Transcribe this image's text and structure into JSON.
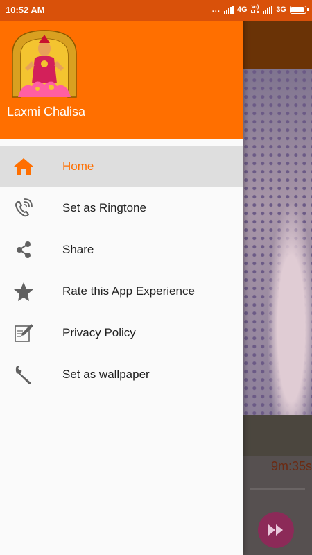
{
  "status_bar": {
    "time": "10:52 AM",
    "dots": "...",
    "network_1": "4G",
    "volte_top": "Vo)",
    "volte_bottom": "LTE",
    "network_2": "3G",
    "battery_level": 0.9
  },
  "drawer": {
    "app_name": "Laxmi Chalisa",
    "menu": [
      {
        "label": "Home",
        "icon": "home-icon",
        "active": true
      },
      {
        "label": "Set as Ringtone",
        "icon": "phone-icon",
        "active": false
      },
      {
        "label": "Share",
        "icon": "share-icon",
        "active": false
      },
      {
        "label": "Rate this App Experience",
        "icon": "star-icon",
        "active": false
      },
      {
        "label": "Privacy Policy",
        "icon": "edit-document-icon",
        "active": false
      },
      {
        "label": "Set as wallpaper",
        "icon": "wrench-icon",
        "active": false
      }
    ]
  },
  "background_app": {
    "timer": "9m:35s"
  },
  "colors": {
    "accent": "#ff6f00",
    "status_bar": "#d9510a",
    "icon_gray": "#616161"
  }
}
